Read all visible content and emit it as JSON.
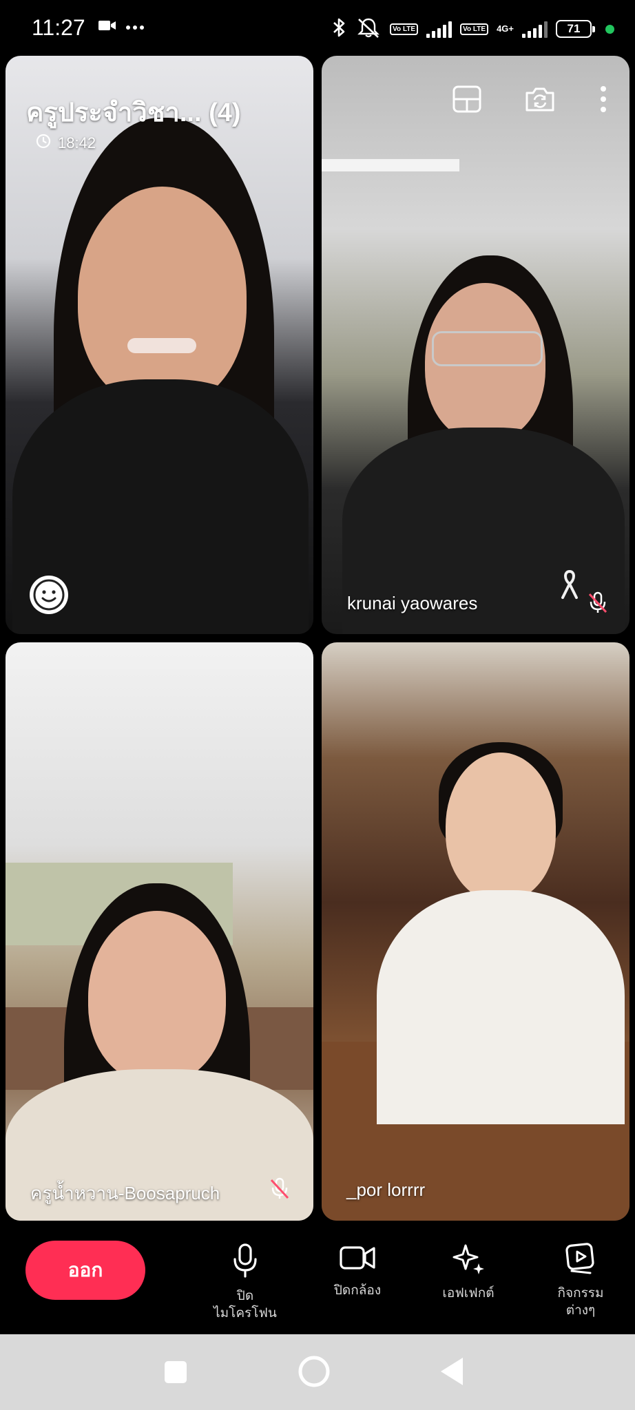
{
  "status_bar": {
    "time": "11:27",
    "battery": "71",
    "volte_label_1": "Vo LTE",
    "volte_label_2": "Vo LTE",
    "network_type": "4G+",
    "icons": [
      "video-recording-icon",
      "more-dots-icon",
      "bluetooth-icon",
      "mute-icon",
      "signal-icon",
      "battery-icon"
    ],
    "indicator_color": "#22c55e"
  },
  "meeting": {
    "title": "ครูประจำวิชา... (4)",
    "duration": "18:42"
  },
  "participants": [
    {
      "name": "",
      "mic_muted": false
    },
    {
      "name": "krunai yaowares",
      "mic_muted": true
    },
    {
      "name": "ครูน้ำหวาน-Boosapruch",
      "mic_muted": true
    },
    {
      "name": "_por lorrrr",
      "mic_muted": false
    }
  ],
  "controls": {
    "leave_label": "ออก",
    "mic_label": "ปิด\nไมโครโฟน",
    "camera_label": "ปิดกล้อง",
    "effects_label": "เอฟเฟกต์",
    "activities_label": "กิจกรรม\nต่างๆ",
    "leave_color": "#ff2e54"
  }
}
